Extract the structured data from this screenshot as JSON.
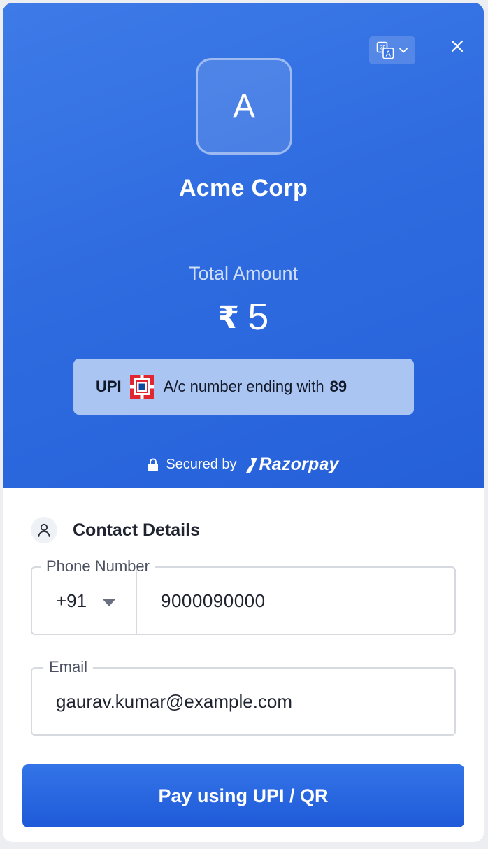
{
  "header": {
    "logo_letter": "A",
    "merchant_name": "Acme Corp",
    "total_label": "Total Amount",
    "currency_symbol": "₹",
    "amount": "5",
    "upi_card": {
      "method": "UPI",
      "bank_icon": "hdfc-bank-logo",
      "text": "A/c number ending with",
      "last_digits": "89"
    },
    "secured_by": "Secured by",
    "brand": "Razorpay",
    "language_icon": "translate-icon",
    "close_icon": "close-icon"
  },
  "contact": {
    "title": "Contact Details",
    "icon": "user-icon",
    "phone": {
      "legend": "Phone Number",
      "country_code": "+91",
      "value": "9000090000"
    },
    "email": {
      "legend": "Email",
      "value": "gaurav.kumar@example.com"
    }
  },
  "pay_button": "Pay using UPI / QR",
  "colors": {
    "header_start": "#3e7be8",
    "header_end": "#2560d9",
    "upi_card_bg": "#abc5f2",
    "button": "#2563eb",
    "bank_red": "#e02630",
    "bank_blue": "#0a4a9f"
  }
}
